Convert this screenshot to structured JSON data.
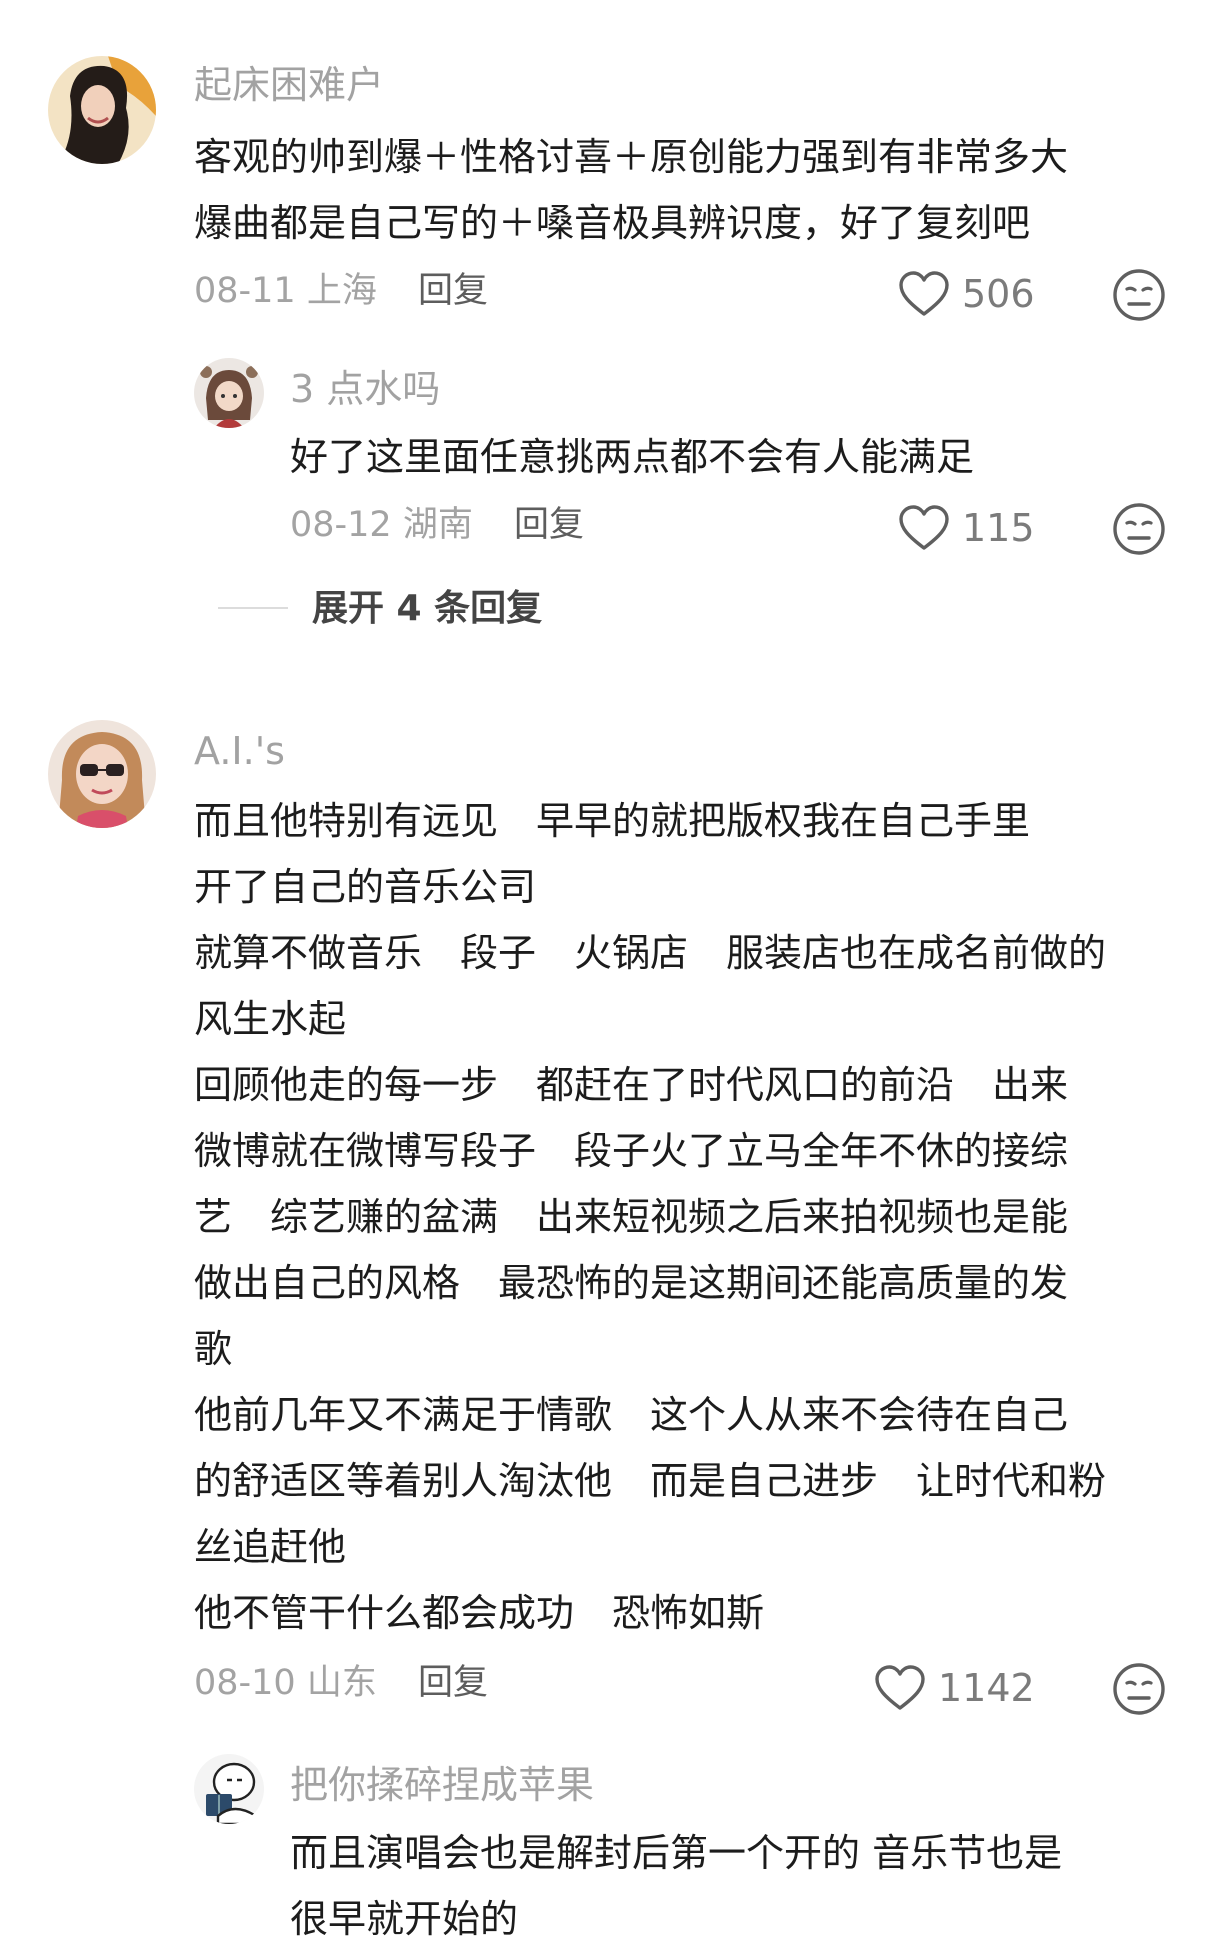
{
  "comments": [
    {
      "username": "起床困难户",
      "lines": [
        "客观的帅到爆＋性格讨喜＋原创能力强到有非常多大",
        "爆曲都是自己写的＋嗓音极具辨识度，好了复刻吧"
      ],
      "date": "08-11",
      "location": "上海",
      "reply_label": "回复",
      "likes": "506",
      "replies": [
        {
          "username": "3 点水吗",
          "lines": [
            "好了这里面任意挑两点都不会有人能满足"
          ],
          "date": "08-12",
          "location": "湖南",
          "reply_label": "回复",
          "likes": "115"
        }
      ],
      "expand_label": "展开 4 条回复"
    },
    {
      "username": "A.I.'s",
      "lines": [
        "而且他特别有远见　早早的就把版权我在自己手里",
        "开了自己的音乐公司",
        "就算不做音乐　段子　火锅店　服装店也在成名前做的",
        "风生水起",
        "回顾他走的每一步　都赶在了时代风口的前沿　出来",
        "微博就在微博写段子　段子火了立马全年不休的接综",
        "艺　综艺赚的盆满　出来短视频之后来拍视频也是能",
        "做出自己的风格　最恐怖的是这期间还能高质量的发",
        "歌",
        "他前几年又不满足于情歌　这个人从来不会待在自己",
        "的舒适区等着别人淘汰他　而是自己进步　让时代和粉",
        "丝追赶他",
        "他不管干什么都会成功　恐怖如斯"
      ],
      "date": "08-10",
      "location": "山东",
      "reply_label": "回复",
      "likes": "1142",
      "replies": [
        {
          "username": "把你揉碎捏成苹果",
          "lines": [
            "而且演唱会也是解封后第一个开的 音乐节也是",
            "很早就开始的"
          ]
        }
      ]
    }
  ],
  "icons": {
    "like": "heart-outline-icon",
    "dislike": "meh-face-icon"
  },
  "colors": {
    "username": "#a2a2a2",
    "text": "#1c1c1c",
    "meta": "#a3a3a3"
  }
}
